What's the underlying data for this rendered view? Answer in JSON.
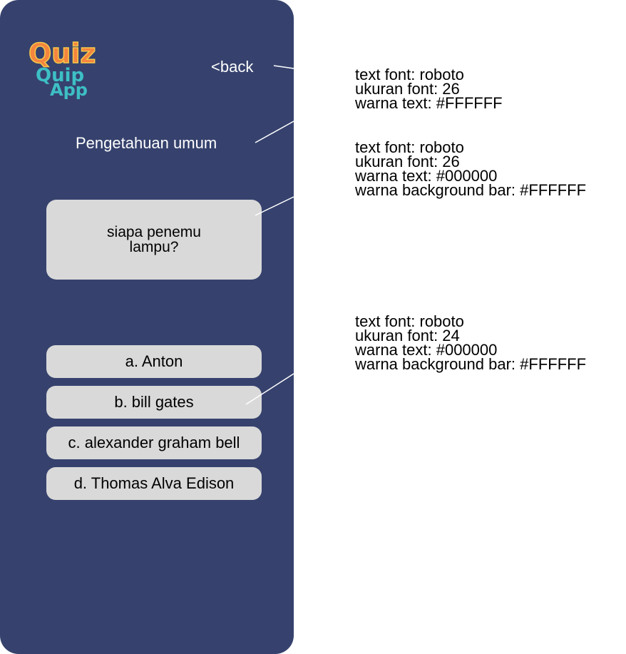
{
  "app": {
    "logo_line1": "Quiz",
    "logo_line2": "Quip",
    "logo_line3": "App",
    "back_label": "<back",
    "category": "Pengetahuan umum"
  },
  "question": {
    "text": "siapa penemu lampu?"
  },
  "options": [
    {
      "label": "a. Anton"
    },
    {
      "label": "b. bill gates"
    },
    {
      "label": "c. alexander graham bell"
    },
    {
      "label": "d. Thomas Alva Edison"
    }
  ],
  "annotations": [
    {
      "lines": [
        "text font: roboto",
        "ukuran font: 26",
        "warna text: #FFFFFF"
      ]
    },
    {
      "lines": [
        "text font: roboto",
        "ukuran font: 26",
        "warna text: #000000",
        "warna background bar: #FFFFFF"
      ]
    },
    {
      "lines": [
        "text font: roboto",
        "ukuran font: 24",
        "warna text: #000000",
        "warna background bar: #FFFFFF"
      ]
    }
  ],
  "colors": {
    "panel_bg": "#36426D",
    "card_bg": "#D9D9D9",
    "logo_orange": "#F5853F",
    "logo_teal": "#3DBFC5",
    "logo_yellow": "#F7C948"
  }
}
